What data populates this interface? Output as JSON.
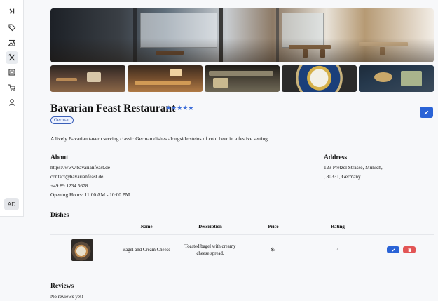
{
  "sidebar": {
    "items": [
      {
        "name": "collapse",
        "icon": "chevron-right-bar-icon"
      },
      {
        "name": "tags",
        "icon": "tag-icon"
      },
      {
        "name": "places",
        "icon": "map-icon"
      },
      {
        "name": "restaurants",
        "icon": "utensils-icon",
        "active": true
      },
      {
        "name": "menus",
        "icon": "menu-board-icon"
      },
      {
        "name": "orders",
        "icon": "cart-icon"
      },
      {
        "name": "users",
        "icon": "user-icon"
      }
    ],
    "avatar": "AD"
  },
  "restaurant": {
    "name": "Bavarian Feast Restaurant",
    "stars": "★★★★★",
    "cuisine": "German",
    "description": "A lively Bavarian tavern serving classic German dishes alongside steins of cold beer in a festive setting."
  },
  "about": {
    "heading": "About",
    "website": "https://www.bavarianfeast.de",
    "email": "contact@bavarianfeast.de",
    "phone": "+49 89 1234 5678",
    "hours": "Opening Hours: 11:00 AM - 10:00 PM"
  },
  "address": {
    "heading": "Address",
    "line1": "123 Pretzel Strasse, Munich,",
    "line2": ", 80331, Germany"
  },
  "dishes": {
    "heading": "Dishes",
    "columns": [
      "Name",
      "Description",
      "Price",
      "Rating"
    ],
    "rows": [
      {
        "name": "Bagel and Cream Cheese",
        "description_line1": "Toasted bagel with creamy",
        "description_line2": "cheese spread.",
        "price": "$5",
        "rating": "4"
      }
    ]
  },
  "reviews": {
    "heading": "Reviews",
    "empty": "No reviews yet!"
  },
  "colors": {
    "accent": "#2a63d6",
    "danger": "#e25555",
    "star": "#3f6fd9"
  }
}
